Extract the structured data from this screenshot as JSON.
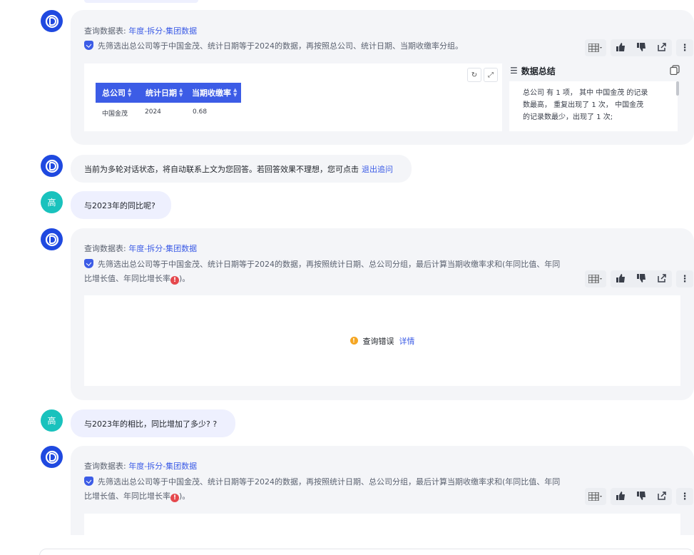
{
  "messages": {
    "m1": {
      "query_table_prefix": "查询数据表:",
      "query_table_link": "年度-拆分-集团数据",
      "description": "先筛选出总公司等于中国金茂、统计日期等于2024的数据，再按照总公司、统计日期、当期收缴率分组。",
      "table": {
        "headers": [
          "总公司",
          "统计日期",
          "当期收缴率"
        ],
        "rows": [
          [
            "中国金茂",
            "2024",
            "0.68"
          ]
        ]
      },
      "summary": {
        "title": "数据总结",
        "text_line1": "总公司 有 1 项， 其中 中国金茂 的记录",
        "text_line2": "数最高， 重复出现了 1 次， 中国金茂",
        "text_line3": "的记录数最少，出现了 1 次;"
      }
    },
    "system_notice": {
      "text": "当前为多轮对话状态，将自动联系上文为您回答。若回答效果不理想，您可点击",
      "link": "退出追问"
    },
    "user1": {
      "avatar_text": "高",
      "text": "与2023年的同比呢?"
    },
    "m2": {
      "query_table_prefix": "查询数据表:",
      "query_table_link": "年度-拆分-集团数据",
      "description_line1": "先筛选出总公司等于中国金茂、统计日期等于2024的数据，再按照统计日期、总公司分组，最后计算当期收缴率求和(年同比值、年同",
      "description_line2": "比增长值、年同比增长率",
      "description_end": ")。",
      "error_text": "查询错误",
      "error_link": "详情"
    },
    "user2": {
      "avatar_text": "高",
      "text": "与2023年的相比，同比增加了多少? ?"
    },
    "m3": {
      "query_table_prefix": "查询数据表:",
      "query_table_link": "年度-拆分-集团数据",
      "description_line1": "先筛选出总公司等于中国金茂、统计日期等于2024的数据，再按照统计日期、总公司分组，最后计算当期收缴率求和(年同比值、年同",
      "description_line2": "比增长值、年同比增长率",
      "description_end": ")。"
    }
  },
  "colors": {
    "accent": "#3c5ce6",
    "bot_avatar": "#1f49e0",
    "user_avatar": "#19c2bd",
    "error": "#e5484d",
    "warning": "#f5a623"
  },
  "icons": [
    "bot-avatar-icon",
    "table-view-icon",
    "thumbs-up-icon",
    "thumbs-down-icon",
    "share-icon",
    "more-icon",
    "refresh-icon",
    "fullscreen-icon",
    "list-icon",
    "copy-icon",
    "shield-icon",
    "error-icon",
    "warning-icon"
  ]
}
